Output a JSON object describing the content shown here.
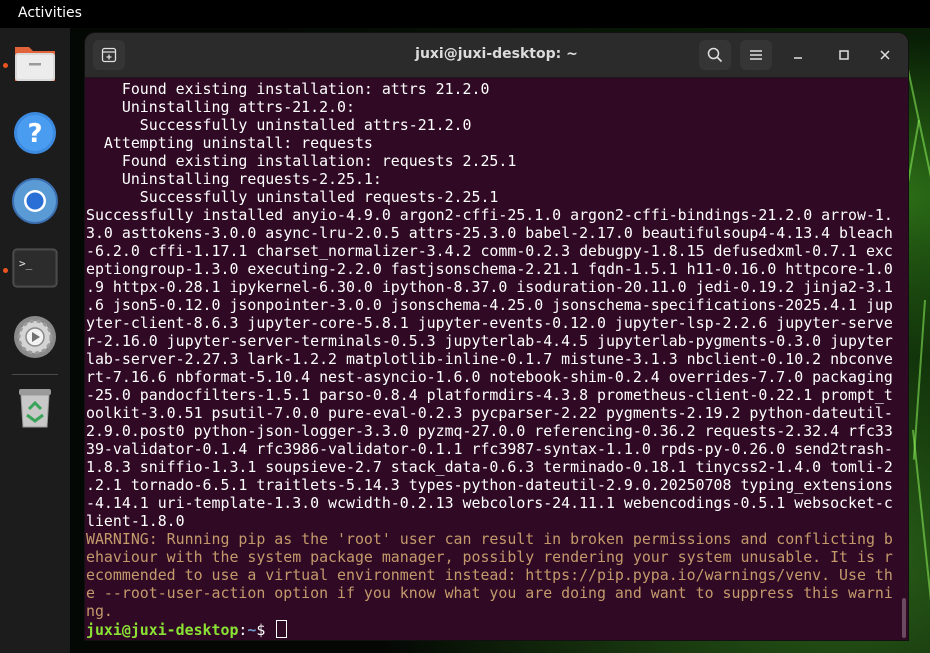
{
  "topbar": {
    "activities": "Activities"
  },
  "dock": {
    "items": [
      {
        "name": "files-icon",
        "running": true
      },
      {
        "name": "help-icon",
        "running": false
      },
      {
        "name": "chromium-icon",
        "running": false
      },
      {
        "name": "terminal-icon",
        "running": true
      },
      {
        "name": "settings-icon",
        "running": false
      },
      {
        "name": "trash-icon",
        "running": false
      }
    ]
  },
  "window": {
    "title": "juxi@juxi-desktop: ~",
    "buttons": {
      "new_tab": "new-tab-icon",
      "search": "search-icon",
      "menu": "hamburger-menu-icon",
      "minimize": "minimize-icon",
      "maximize": "maximize-icon",
      "close": "close-icon"
    }
  },
  "terminal": {
    "lines": [
      "    Found existing installation: attrs 21.2.0",
      "    Uninstalling attrs-21.2.0:",
      "      Successfully uninstalled attrs-21.2.0",
      "  Attempting uninstall: requests",
      "    Found existing installation: requests 2.25.1",
      "    Uninstalling requests-2.25.1:",
      "      Successfully uninstalled requests-2.25.1",
      "Successfully installed anyio-4.9.0 argon2-cffi-25.1.0 argon2-cffi-bindings-21.2.0 arrow-1.",
      "3.0 asttokens-3.0.0 async-lru-2.0.5 attrs-25.3.0 babel-2.17.0 beautifulsoup4-4.13.4 bleach",
      "-6.2.0 cffi-1.17.1 charset_normalizer-3.4.2 comm-0.2.3 debugpy-1.8.15 defusedxml-0.7.1 exc",
      "eptiongroup-1.3.0 executing-2.2.0 fastjsonschema-2.21.1 fqdn-1.5.1 h11-0.16.0 httpcore-1.0",
      ".9 httpx-0.28.1 ipykernel-6.30.0 ipython-8.37.0 isoduration-20.11.0 jedi-0.19.2 jinja2-3.1",
      ".6 json5-0.12.0 jsonpointer-3.0.0 jsonschema-4.25.0 jsonschema-specifications-2025.4.1 jup",
      "yter-client-8.6.3 jupyter-core-5.8.1 jupyter-events-0.12.0 jupyter-lsp-2.2.6 jupyter-serve",
      "r-2.16.0 jupyter-server-terminals-0.5.3 jupyterlab-4.4.5 jupyterlab-pygments-0.3.0 jupyter",
      "lab-server-2.27.3 lark-1.2.2 matplotlib-inline-0.1.7 mistune-3.1.3 nbclient-0.10.2 nbconve",
      "rt-7.16.6 nbformat-5.10.4 nest-asyncio-1.6.0 notebook-shim-0.2.4 overrides-7.7.0 packaging",
      "-25.0 pandocfilters-1.5.1 parso-0.8.4 platformdirs-4.3.8 prometheus-client-0.22.1 prompt_t",
      "oolkit-3.0.51 psutil-7.0.0 pure-eval-0.2.3 pycparser-2.22 pygments-2.19.2 python-dateutil-",
      "2.9.0.post0 python-json-logger-3.3.0 pyzmq-27.0.0 referencing-0.36.2 requests-2.32.4 rfc33",
      "39-validator-0.1.4 rfc3986-validator-0.1.1 rfc3987-syntax-1.1.0 rpds-py-0.26.0 send2trash-",
      "1.8.3 sniffio-1.3.1 soupsieve-2.7 stack_data-0.6.3 terminado-0.18.1 tinycss2-1.4.0 tomli-2",
      ".2.1 tornado-6.5.1 traitlets-5.14.3 types-python-dateutil-2.9.0.20250708 typing_extensions",
      "-4.14.1 uri-template-1.3.0 wcwidth-0.2.13 webcolors-24.11.1 webencodings-0.5.1 websocket-c",
      "lient-1.8.0"
    ],
    "warning_lines": [
      "WARNING: Running pip as the 'root' user can result in broken permissions and conflicting b",
      "ehaviour with the system package manager, possibly rendering your system unusable. It is r",
      "ecommended to use a virtual environment instead: https://pip.pypa.io/warnings/venv. Use th",
      "e --root-user-action option if you know what you are doing and want to suppress this warni",
      "ng."
    ],
    "prompt": {
      "user_host": "juxi@juxi-desktop",
      "sep": ":",
      "path": "~",
      "symbol": "$ "
    }
  },
  "colors": {
    "terminal_bg": "#300a24",
    "prompt_user": "#8ae234",
    "prompt_path": "#729fcf",
    "warning": "#c49a6c",
    "accent": "#e95420"
  }
}
